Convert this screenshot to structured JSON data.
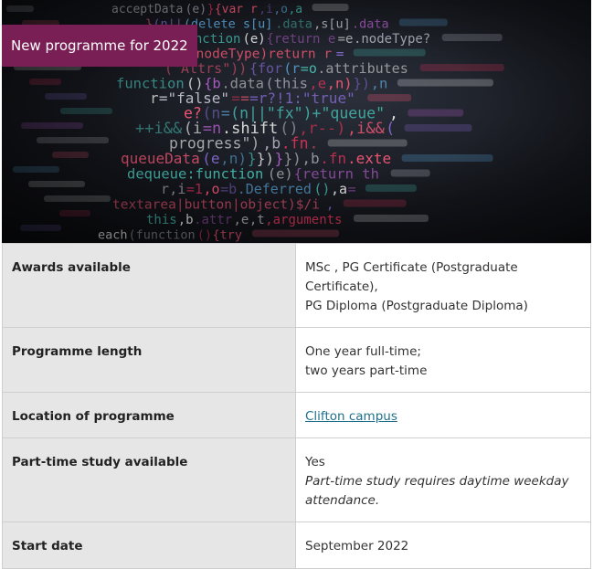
{
  "hero": {
    "badge_text": "New programme for 2022",
    "image_icon": "code-screen-image",
    "code_lines": [
      "acceptData(e)}{var r,i,o,a",
      "}(n||(delete s[u].data,s[u].data",
      "function(e){return e=e.nodeType?",
      "e&&!==e.nodeType)return r=",
      "(\"Attrs\")){for(r=o.attributes",
      "function(){b.data(this,e,n)}),n",
      "r=\"false\"===r?!1:\"true\"",
      "e?(n=(n||\"fx\")+\"queue\",",
      "++i&&(i=n.shift(),r--),i&&(",
      "progress\"),b.fn.",
      "queueData(e,n)}})}}),b.fn.exte",
      "dequeue:function(e){return th",
      "r,i=1,o=b.Deferred(),a=",
      "textarea|button|object)$/i,",
      "this,b.attr,e,t,arguments",
      "each(function(){try"
    ]
  },
  "table": {
    "rows": [
      {
        "label": "Awards available",
        "value_lines": [
          "MSc , PG Certificate (Postgraduate Certificate),",
          "PG Diploma (Postgraduate Diploma)"
        ]
      },
      {
        "label": "Programme length",
        "value_lines": [
          "One year full-time;",
          "two years part-time"
        ]
      },
      {
        "label": "Location of programme",
        "link_text": "Clifton campus"
      },
      {
        "label": "Part-time study available",
        "value_lines": [
          "Yes"
        ],
        "note": "Part-time study requires daytime weekday attendance."
      },
      {
        "label": "Start date",
        "value_lines": [
          "September 2022"
        ]
      }
    ]
  },
  "colors": {
    "badge_bg": "#7a1f55",
    "label_bg": "#e6e6e6",
    "link": "#1f6f8b",
    "border": "#cfcfcf"
  }
}
